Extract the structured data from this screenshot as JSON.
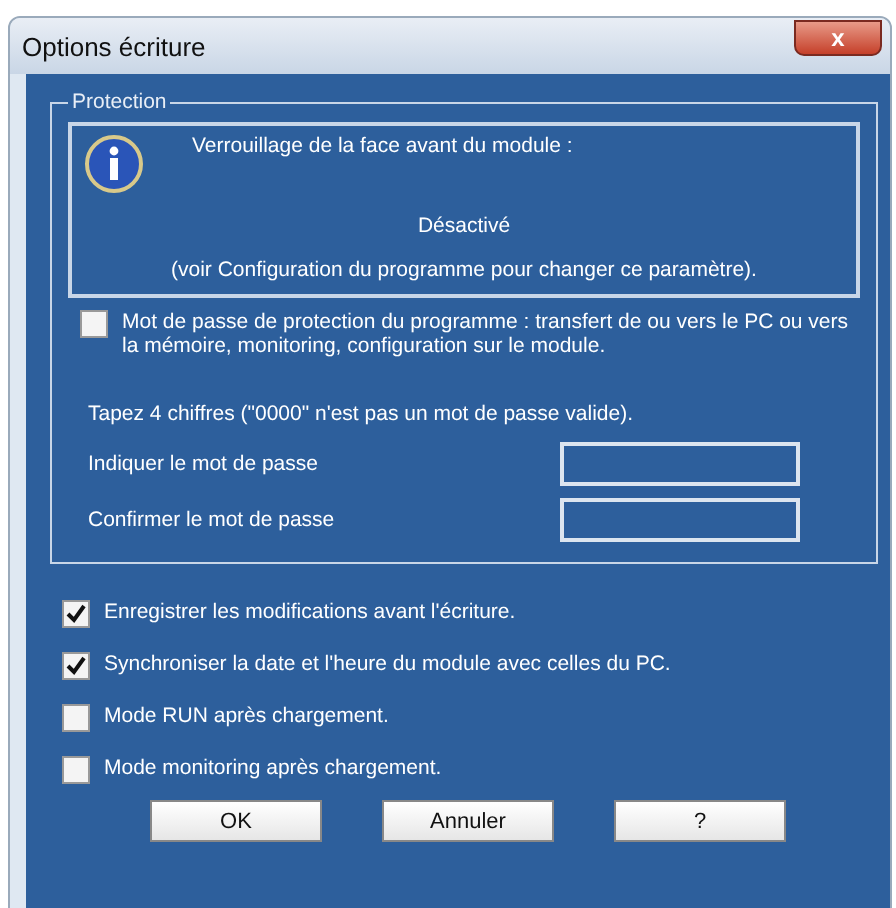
{
  "window": {
    "title": "Options écriture",
    "close_label": "x"
  },
  "protection": {
    "title": "Protection",
    "info": {
      "heading": "Verrouillage de la face avant du module :",
      "status": "Désactivé",
      "note": "(voir Configuration du programme pour changer ce paramètre)."
    },
    "password_option": {
      "label": "Mot de passe de protection du programme : transfert de ou vers le PC ou vers la mémoire, monitoring, configuration sur le module.",
      "checked": false
    },
    "hint": "Tapez 4 chiffres (\"0000\" n'est pas un mot de passe valide).",
    "fields": [
      {
        "label": "Indiquer le mot de passe"
      },
      {
        "label": "Confirmer le mot de passe"
      }
    ]
  },
  "options": [
    {
      "label": "Enregistrer les modifications avant l'écriture.",
      "checked": true
    },
    {
      "label": "Synchroniser la date et l'heure du module avec celles du PC.",
      "checked": true
    },
    {
      "label": "Mode RUN après chargement.",
      "checked": false
    },
    {
      "label": "Mode monitoring après chargement.",
      "checked": false
    }
  ],
  "buttons": [
    "OK",
    "Annuler",
    "?"
  ]
}
